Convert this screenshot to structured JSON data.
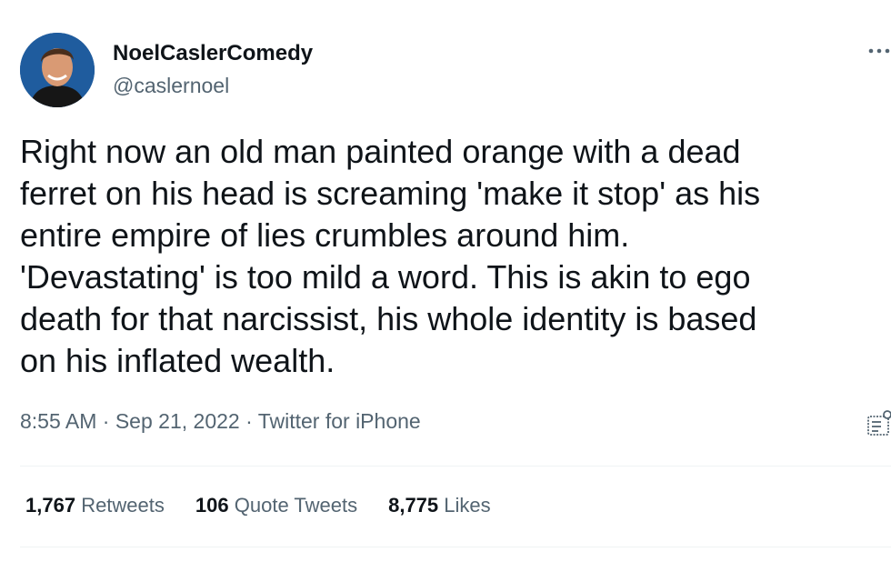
{
  "author": {
    "name": "NoelCaslerComedy",
    "handle": "@caslernoel"
  },
  "tweet": {
    "text_lines": [
      "Right now an old man painted orange with a dead",
      "ferret on his head is screaming 'make it stop' as his",
      "entire empire of lies crumbles around him.",
      "'Devastating' is too mild a word. This is akin to ego",
      "death for that narcissist, his whole identity is based",
      "on his inflated wealth."
    ],
    "time": "8:55 AM",
    "date": "Sep 21, 2022",
    "source": "Twitter for iPhone",
    "separator": " · "
  },
  "stats": {
    "retweets_count": "1,767",
    "retweets_label": "Retweets",
    "quotes_count": "106",
    "quotes_label": "Quote Tweets",
    "likes_count": "8,775",
    "likes_label": "Likes"
  },
  "icons": {
    "more": "more-horizontal-icon",
    "analytics": "analytics-icon"
  },
  "colors": {
    "text": "#0f1419",
    "secondary": "#536471",
    "divider": "#eff3f4"
  }
}
